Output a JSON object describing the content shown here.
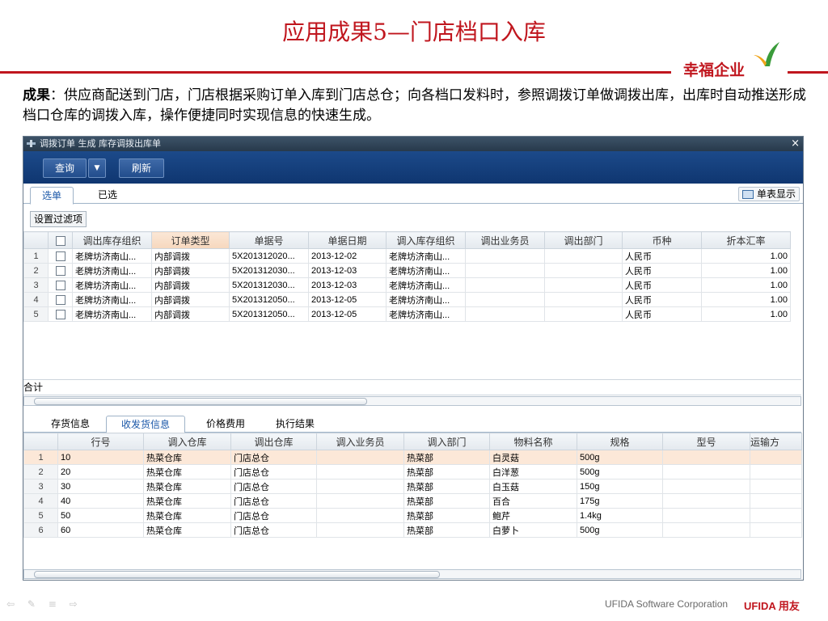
{
  "slide": {
    "title": "应用成果5—门店档口入库",
    "logo": "幸福企业",
    "desc_label": "成果",
    "desc_text": "：供应商配送到门店，门店根据采购订单入库到门店总仓；向各档口发料时，参照调拨订单做调拨出库，出库时自动推送形成档口仓库的调拨入库，操作便捷同时实现信息的快速生成。",
    "footer_text": "UFIDA Software Corporation",
    "footer_brand": "UFIDA 用友"
  },
  "window": {
    "title": "调拨订单 生成 库存调拨出库单",
    "close_label": "×",
    "query_label": "查询",
    "dropdown_label": "▼",
    "refresh_label": "刷新",
    "tab_select": "选单",
    "tab_selected": "已选",
    "single_display": "单表显示",
    "filter_label": "设置过滤项",
    "total_label": "合计"
  },
  "top_table": {
    "headers": [
      "",
      "",
      "调出库存组织",
      "订单类型",
      "单据号",
      "单据日期",
      "调入库存组织",
      "调出业务员",
      "调出部门",
      "币种",
      "折本汇率"
    ],
    "rows": [
      [
        "1",
        "老牌坊济南山...",
        "内部调拨",
        "5X201312020...",
        "2013-12-02",
        "老牌坊济南山...",
        "",
        "",
        "人民币",
        "1.00"
      ],
      [
        "2",
        "老牌坊济南山...",
        "内部调拨",
        "5X201312030...",
        "2013-12-03",
        "老牌坊济南山...",
        "",
        "",
        "人民币",
        "1.00"
      ],
      [
        "3",
        "老牌坊济南山...",
        "内部调拨",
        "5X201312030...",
        "2013-12-03",
        "老牌坊济南山...",
        "",
        "",
        "人民币",
        "1.00"
      ],
      [
        "4",
        "老牌坊济南山...",
        "内部调拨",
        "5X201312050...",
        "2013-12-05",
        "老牌坊济南山...",
        "",
        "",
        "人民币",
        "1.00"
      ],
      [
        "5",
        "老牌坊济南山...",
        "内部调拨",
        "5X201312050...",
        "2013-12-05",
        "老牌坊济南山...",
        "",
        "",
        "人民币",
        "1.00"
      ]
    ]
  },
  "bottom_tabs": [
    "存货信息",
    "收发货信息",
    "价格费用",
    "执行结果"
  ],
  "bottom_table": {
    "headers": [
      "",
      "行号",
      "调入仓库",
      "调出仓库",
      "调入业务员",
      "调入部门",
      "物料名称",
      "规格",
      "型号",
      "运输方"
    ],
    "rows": [
      [
        "1",
        "10",
        "热菜仓库",
        "门店总仓",
        "",
        "热菜部",
        "白灵菇",
        "500g",
        "",
        ""
      ],
      [
        "2",
        "20",
        "热菜仓库",
        "门店总仓",
        "",
        "热菜部",
        "白洋葱",
        "500g",
        "",
        ""
      ],
      [
        "3",
        "30",
        "热菜仓库",
        "门店总仓",
        "",
        "热菜部",
        "白玉菇",
        "150g",
        "",
        ""
      ],
      [
        "4",
        "40",
        "热菜仓库",
        "门店总仓",
        "",
        "热菜部",
        "百合",
        "175g",
        "",
        ""
      ],
      [
        "5",
        "50",
        "热菜仓库",
        "门店总仓",
        "",
        "热菜部",
        "鲍芹",
        "1.4kg",
        "",
        ""
      ],
      [
        "6",
        "60",
        "热菜仓库",
        "门店总仓",
        "",
        "热菜部",
        "白萝卜",
        "500g",
        "",
        ""
      ]
    ]
  },
  "colors": {
    "accent": "#c0161e",
    "toolbar": "#1c4a8a",
    "selected_row": "#fce8d8"
  }
}
